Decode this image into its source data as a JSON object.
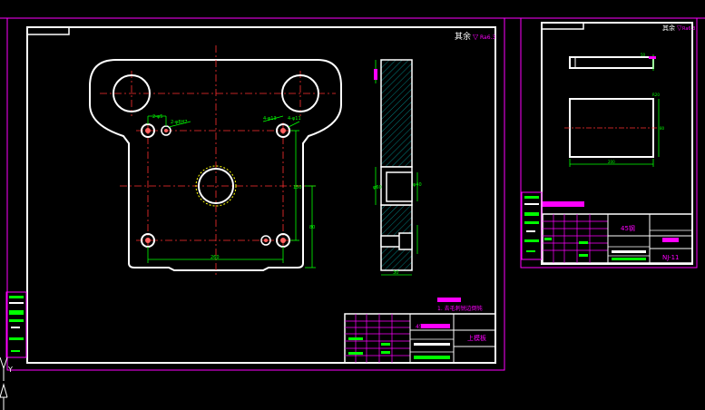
{
  "colors": {
    "background": "#000000",
    "outline": "#ffffff",
    "border": "#ff00ff",
    "centerline": "#ff3030",
    "dimension": "#00ff00",
    "hatch": "#00a0a0",
    "hole_fill": "#ff6060"
  },
  "main_sheet": {
    "roughness_note": "其余",
    "roughness_value": "Ra6.3",
    "tech_note": "1. 去毛刺锐边倒钝",
    "material": "45",
    "title_label": "上模板"
  },
  "plan_view_dimensions": {
    "top_left_hole": "2-φ5",
    "top_left_pin": "2-φ8H7",
    "top_right_hole": "4-φ13",
    "top_right_pin": "4-φ11",
    "overall_width": "260",
    "height_a": "150",
    "height_b": "80"
  },
  "section_view_dimensions": {
    "thickness": "30",
    "bore": "φ60",
    "bore_depth": "φ40"
  },
  "part_sheet": {
    "roughness_note": "其余",
    "roughness_value": "Ra6.3",
    "material": "45钢",
    "drawing_no": "NJ-11",
    "top_block_dim": "50",
    "width_dim": "200",
    "height_dim": "80",
    "corner_dim": "R20"
  },
  "ucs_icon": {
    "y_axis": "Y"
  }
}
